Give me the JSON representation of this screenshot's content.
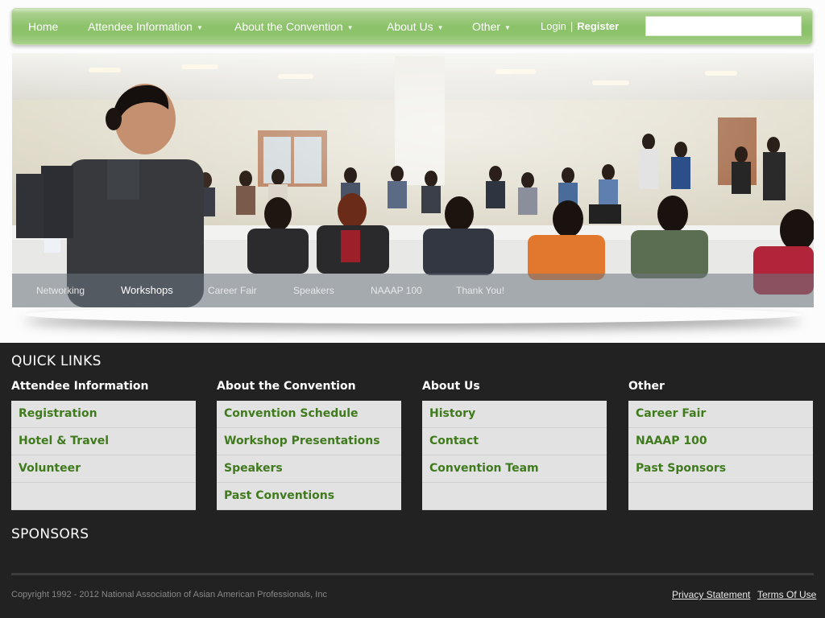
{
  "nav": {
    "items": [
      {
        "label": "Home",
        "caret": ""
      },
      {
        "label": "Attendee Information",
        "caret": "▼"
      },
      {
        "label": "About the Convention",
        "caret": "▼"
      },
      {
        "label": "About Us",
        "caret": "▼"
      },
      {
        "label": "Other",
        "caret": "▼"
      }
    ],
    "login": "Login",
    "separator": "|",
    "register": "Register",
    "search_value": ""
  },
  "slider": {
    "tabs": [
      "Networking",
      "Workshops",
      "Career Fair",
      "Speakers",
      "NAAAP 100",
      "Thank You!"
    ],
    "active_tab": "Workshops"
  },
  "footer": {
    "quick_links_title": "QUICK LINKS",
    "columns": [
      {
        "title": "Attendee Information",
        "links": [
          "Registration",
          "Hotel & Travel",
          "Volunteer",
          ""
        ]
      },
      {
        "title": "About the Convention",
        "links": [
          "Convention Schedule",
          "Workshop Presentations",
          "Speakers",
          "Past Conventions"
        ]
      },
      {
        "title": "About Us",
        "links": [
          "History",
          "Contact",
          "Convention Team",
          ""
        ]
      },
      {
        "title": "Other",
        "links": [
          "Career Fair",
          "NAAAP 100",
          "Past Sponsors",
          ""
        ]
      }
    ],
    "sponsors_title": "SPONSORS",
    "copyright": "Copyright 1992 - 2012 National Association of Asian American Professionals, Inc",
    "privacy": "Privacy Statement",
    "terms": "Terms Of Use"
  },
  "colors": {
    "nav_green": "#8cc26a",
    "link_green": "#3f7a1c",
    "footer_bg": "#222222"
  }
}
